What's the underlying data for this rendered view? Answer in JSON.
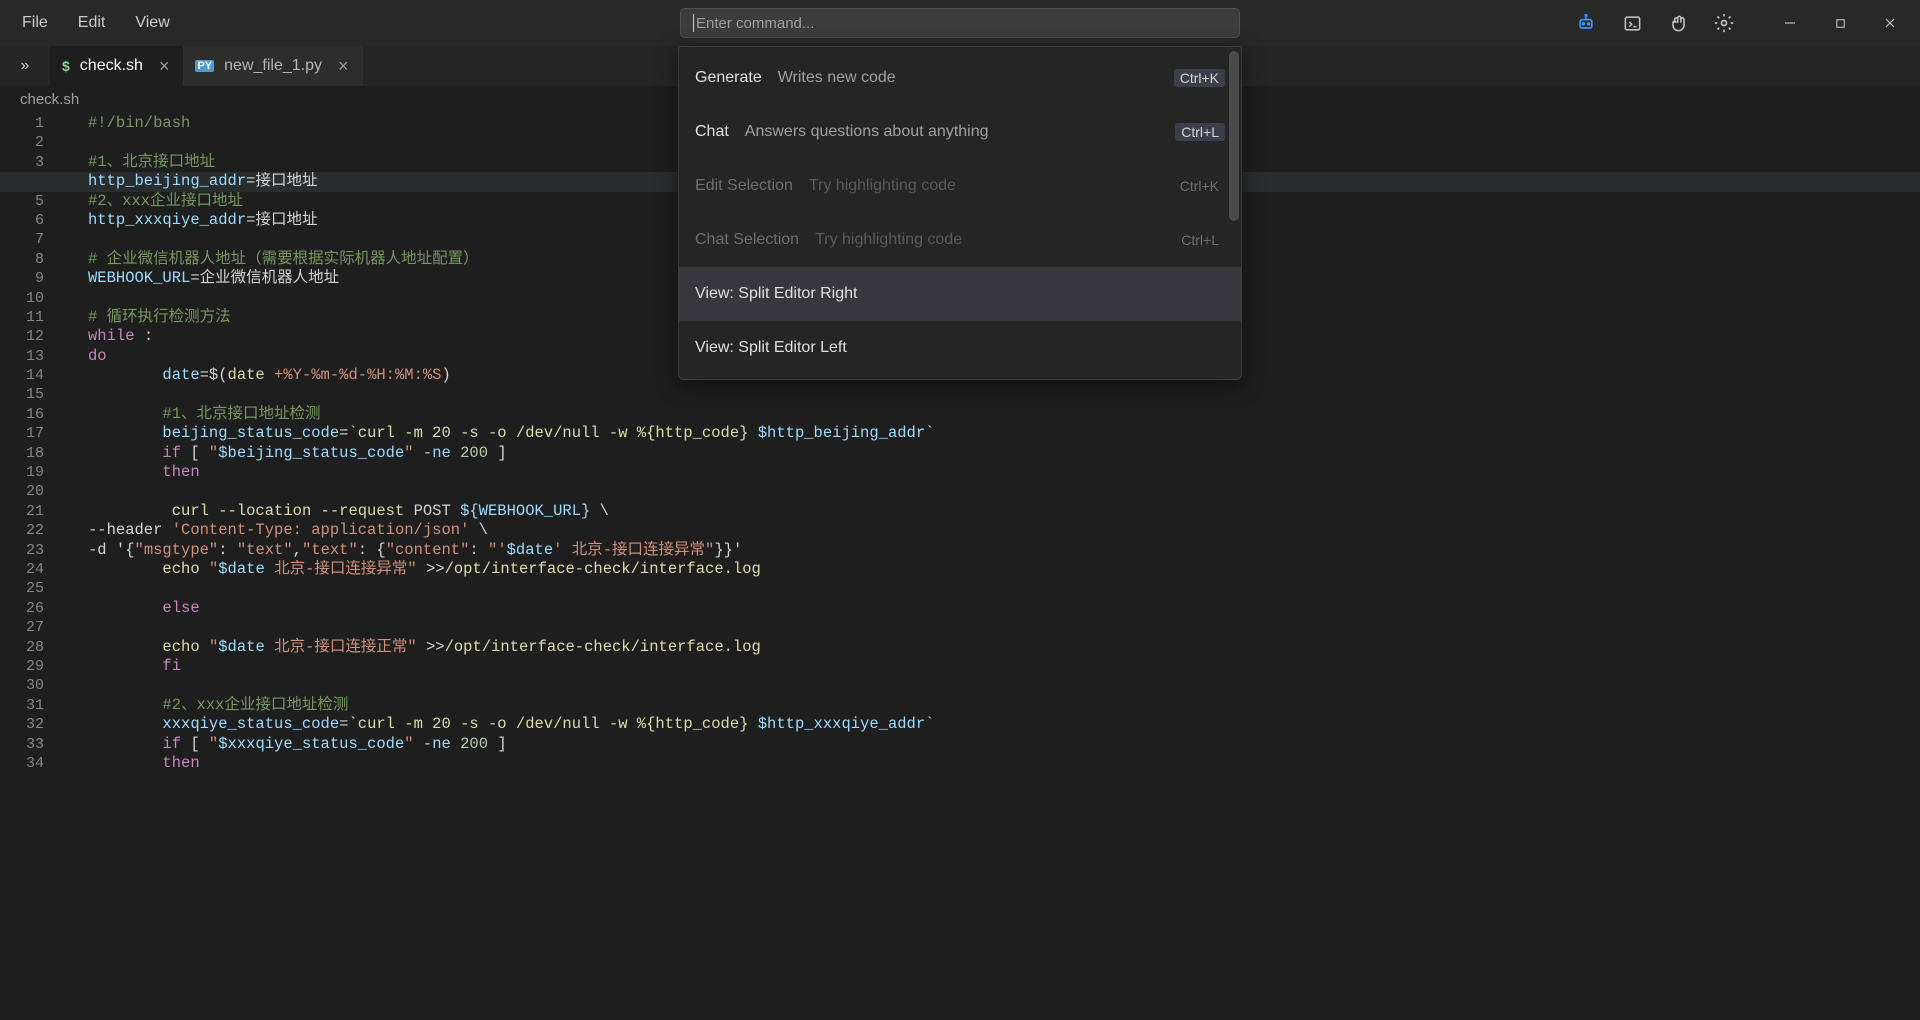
{
  "menubar": {
    "file": "File",
    "edit": "Edit",
    "view": "View"
  },
  "command_input": {
    "placeholder": "Enter command..."
  },
  "tabs": [
    {
      "icon": "$",
      "label": "check.sh",
      "active": true
    },
    {
      "icon": "PY",
      "label": "new_file_1.py",
      "active": false
    }
  ],
  "breadcrumb": "check.sh",
  "palette": {
    "items": [
      {
        "title": "Generate",
        "desc": "Writes new code",
        "key": "Ctrl+K",
        "disabled": false,
        "selected": false
      },
      {
        "title": "Chat",
        "desc": "Answers questions about anything",
        "key": "Ctrl+L",
        "disabled": false,
        "selected": false
      },
      {
        "title": "Edit Selection",
        "desc": "Try highlighting code",
        "key": "Ctrl+K",
        "disabled": true,
        "selected": false
      },
      {
        "title": "Chat Selection",
        "desc": "Try highlighting code",
        "key": "Ctrl+L",
        "disabled": true,
        "selected": false
      },
      {
        "title": "View: Split Editor Right",
        "desc": "",
        "key": "",
        "disabled": false,
        "selected": true
      },
      {
        "title": "View: Split Editor Left",
        "desc": "",
        "key": "",
        "disabled": false,
        "selected": false
      }
    ]
  },
  "gutter": {
    "start": 1,
    "end": 34,
    "current": 4
  },
  "code": {
    "lines": [
      {
        "t": "comment",
        "pad": 0,
        "text": "#!/bin/bash"
      },
      {
        "t": "blank"
      },
      {
        "t": "comment",
        "pad": 0,
        "text": "#1、北京接口地址"
      },
      {
        "t": "assign",
        "pad": 0,
        "var": "http_beijing_addr",
        "val": "接口地址",
        "hl": true
      },
      {
        "t": "comment",
        "pad": 0,
        "text": "#2、xxx企业接口地址"
      },
      {
        "t": "assign",
        "pad": 0,
        "var": "http_xxxqiye_addr",
        "val": "接口地址"
      },
      {
        "t": "blank"
      },
      {
        "t": "comment",
        "pad": 0,
        "text": "# 企业微信机器人地址（需要根据实际机器人地址配置）"
      },
      {
        "t": "assign",
        "pad": 0,
        "var": "WEBHOOK_URL",
        "val": "企业微信机器人地址"
      },
      {
        "t": "blank"
      },
      {
        "t": "comment",
        "pad": 0,
        "text": "# 循环执行检测方法"
      },
      {
        "t": "while",
        "pad": 0,
        "kw": "while",
        "rest": " :"
      },
      {
        "t": "kw",
        "pad": 0,
        "text": "do"
      },
      {
        "t": "date",
        "pad": 8,
        "var": "date",
        "cmd": "date",
        "fmt": " +%Y-%m-%d-%H:%M:%S"
      },
      {
        "t": "blank"
      },
      {
        "t": "comment",
        "pad": 8,
        "text": "#1、北京接口地址检测"
      },
      {
        "t": "curl1",
        "pad": 8,
        "var": "beijing_status_code",
        "args": "curl -m 20 -s -o /dev/null -w %{http_code} ",
        "varref": "$http_beijing_addr"
      },
      {
        "t": "if",
        "pad": 8,
        "cond_var": "$beijing_status_code",
        "op": "-ne",
        "num": "200"
      },
      {
        "t": "kw",
        "pad": 8,
        "text": "then"
      },
      {
        "t": "blank"
      },
      {
        "t": "curlpost",
        "pad": 9,
        "cmd": "curl --location --request ",
        "method": "POST",
        "url": " ${WEBHOOK_URL}",
        "cont": " \\"
      },
      {
        "t": "header",
        "pad": 0,
        "pre": "--header ",
        "val": "'Content-Type: application/json'",
        "cont": " \\"
      },
      {
        "t": "json",
        "pad": 0,
        "pre": "-d '{",
        "a": "\"msgtype\"",
        "b": "\"text\"",
        "c": "\"text\"",
        "d": "\"content\"",
        "e": "\"'",
        "var": "$date",
        "f": "' 北京-接口连接异常\"",
        "g": "}}'"
      },
      {
        "t": "echo",
        "pad": 8,
        "cmd": "echo",
        "a": " \"",
        "var": "$date",
        "b": " 北京-接口连接异常\"",
        "op": " >>",
        "path": "/opt/interface-check/interface.log"
      },
      {
        "t": "blank"
      },
      {
        "t": "kw",
        "pad": 8,
        "text": "else"
      },
      {
        "t": "blank"
      },
      {
        "t": "echo",
        "pad": 8,
        "cmd": "echo",
        "a": " \"",
        "var": "$date",
        "b": " 北京-接口连接正常\"",
        "op": " >>",
        "path": "/opt/interface-check/interface.log"
      },
      {
        "t": "kw",
        "pad": 8,
        "text": "fi"
      },
      {
        "t": "blank"
      },
      {
        "t": "comment",
        "pad": 8,
        "text": "#2、xxx企业接口地址检测"
      },
      {
        "t": "curl1",
        "pad": 8,
        "var": "xxxqiye_status_code",
        "args": "curl -m 20 -s -o /dev/null -w %{http_code} ",
        "varref": "$http_xxxqiye_addr"
      },
      {
        "t": "if",
        "pad": 8,
        "cond_var": "$xxxqiye_status_code",
        "op": "-ne",
        "num": "200"
      },
      {
        "t": "kw",
        "pad": 8,
        "text": "then"
      }
    ]
  }
}
